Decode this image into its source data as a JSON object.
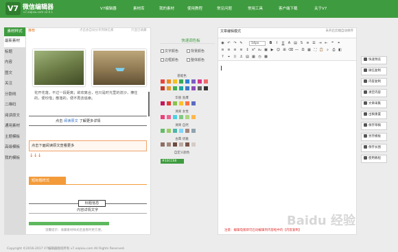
{
  "header": {
    "logo": "V7",
    "brand": "微信编辑器",
    "brand_url": "v7.xiqiaiu.com  v2.0.1",
    "nav": [
      "V7编辑器",
      "素材库",
      "我的素材",
      "使用教程",
      "常见问题",
      "常用工具",
      "客户端下载",
      "关于V7"
    ]
  },
  "sidebar": {
    "head": "素材样式",
    "items": [
      "最新素材",
      "标题",
      "内容",
      "图文",
      "关注",
      "分割线",
      "二维码",
      "阅读原文",
      "通用素材",
      "主题模板",
      "高级模板",
      "我的模板"
    ]
  },
  "left_panel": {
    "tagline": "推荐",
    "hint": "点击会自动分享到微信素",
    "hint2": "只显已收藏",
    "poem": "花开花落，不过一段距离；欲欢离合，也只是时光里的流沙，擦住的，便珍惜；散落的，便不再去追索。",
    "readmore_prefix": "点击",
    "readmore_link": "阅读原文",
    "readmore_suffix": "了解更多详情",
    "orange_box": "点击下面阅读原文查看更多",
    "arrows": "↓↓↓",
    "orange_tag": "短标题样式",
    "title_box": "标题信息",
    "title_sub": "内容详情文字",
    "foot_hint": "温馨提示：收藏素材样式后查看时更方便。"
  },
  "palette": {
    "title": "快速调色板",
    "opt_text_color": "文字颜色",
    "opt_bg_color": "背景颜色",
    "opt_border_color": "边框颜色",
    "opt_all_color": "整体颜色",
    "sections": [
      "基础色",
      "华丽  劲爆",
      "清爽  女性",
      "清简  自然",
      "古典  优雅",
      "自定义颜色"
    ],
    "custom_chip": "#33CC66",
    "colors": {
      "row1": [
        "#e8453c",
        "#f08c1f",
        "#f4c21e",
        "#3aa757",
        "#2f7fd6",
        "#7a5cc4",
        "#d9368b",
        "#ef6b6b"
      ],
      "row2": [
        "#c23a2b",
        "#e69a2a",
        "#3fb050",
        "#1fa6a6",
        "#3f76c8",
        "#8c4bb5",
        "#5f5f5f",
        "#333333"
      ],
      "row3": [
        "#c2185b",
        "#e53935",
        "#8bc34a",
        "#fbc02d",
        "#ff7043",
        "#5c6bc0"
      ],
      "row4": [
        "#ec407a",
        "#f06292",
        "#4dd0e1",
        "#81c784",
        "#aed581",
        "#ffb74d"
      ],
      "row5": [
        "#66bb6a",
        "#9ccc65",
        "#4db6ac",
        "#81d4fa",
        "#a1887f",
        "#90a4ae"
      ],
      "row6": [
        "#8d6e63",
        "#a1887f",
        "#6d4c41",
        "#bcaaa4",
        "#795548",
        "#d7ccc8"
      ]
    }
  },
  "editor": {
    "title": "文章编辑模式",
    "status": "未开启云端自动保存",
    "font_size": "14px",
    "note": "注意：编辑电版即可启动编辑到内容框中的【内容复制】"
  },
  "right_buttons": [
    "快速预览",
    "微信复制",
    "内容复制",
    "清空内容",
    "文章采集",
    "出稿重置",
    "保存草稿",
    "另存模板",
    "保存长图",
    "使用教程"
  ],
  "footer": {
    "copyright": "Copyright ©2016-2017 V7编辑器版权所有 v7.xiqiaiu.com All Rights Reserved."
  },
  "watermark": "Baidu 经验"
}
